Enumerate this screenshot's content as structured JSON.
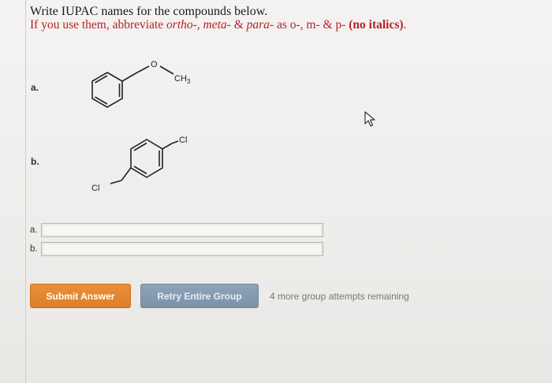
{
  "question": {
    "title": "Write IUPAC names for the compounds below.",
    "instructions": {
      "prefix": "If you use them, abbreviate ",
      "ortho": "ortho-",
      "sep1": ", ",
      "meta": "meta-",
      "sep2": " & ",
      "para": "para-",
      "middle": " as o-, m- & p- ",
      "bold": "(no italics)",
      "suffix": "."
    }
  },
  "compounds": {
    "a": {
      "label": "a.",
      "atom_o": "O",
      "atom_ch3": "CH",
      "atom_ch3_sub": "3"
    },
    "b": {
      "label": "b.",
      "atom_cl_top": "Cl",
      "atom_cl_bottom": "Cl"
    }
  },
  "answers": [
    {
      "label": "a.",
      "value": ""
    },
    {
      "label": "b.",
      "value": ""
    }
  ],
  "buttons": {
    "submit": "Submit Answer",
    "retry": "Retry Entire Group"
  },
  "attempts_text": "4 more group attempts remaining",
  "colors": {
    "instruction_red": "#b5222b",
    "submit_orange": "#de7f26",
    "retry_blue": "#7a93a9"
  }
}
